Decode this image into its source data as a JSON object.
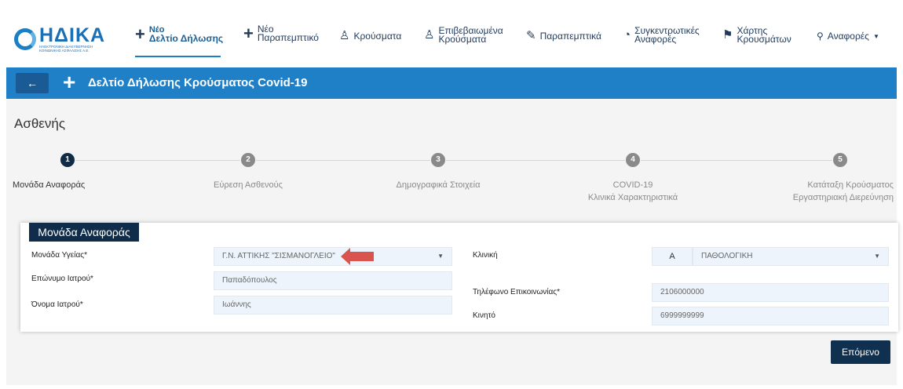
{
  "logo": {
    "title": "ΗΔΙΚΑ",
    "subtitle": "ΗΛΕΚΤΡΟΝΙΚΗ ΔΙΑΚΥΒΕΡΝΗΣΗ ΚΟΙΝΩΝΙΚΗΣ ΑΣΦΑΛΙΣΗΣ Α.Ε."
  },
  "nav": {
    "new_report_l1": "Νέο",
    "new_report_l2": "Δελτίο Δήλωσης",
    "new_ref_l1": "Νέο",
    "new_ref_l2": "Παραπεμπτικό",
    "cases": "Κρούσματα",
    "confirmed_l1": "Επιβεβαιωμένα",
    "confirmed_l2": "Κρούσματα",
    "referrals": "Παραπεμπτικά",
    "summary_l1": "Συγκεντρωτικές",
    "summary_l2": "Αναφορές",
    "map_l1": "Χάρτης",
    "map_l2": "Κρουσμάτων",
    "reports": "Αναφορές"
  },
  "titlebar": {
    "back": "←",
    "plus": "+",
    "title": "Δελτίο Δήλωσης Κρούσματος Covid-19"
  },
  "section_heading": "Ασθενής",
  "steps": [
    {
      "num": "1",
      "line1": "Μονάδα Αναφοράς",
      "line2": ""
    },
    {
      "num": "2",
      "line1": "Εύρεση Ασθενούς",
      "line2": ""
    },
    {
      "num": "3",
      "line1": "Δημογραφικά Στοιχεία",
      "line2": ""
    },
    {
      "num": "4",
      "line1": "COVID-19",
      "line2": "Κλινικά Χαρακτηριστικά"
    },
    {
      "num": "5",
      "line1": "Κατάταξη Κρούσματος",
      "line2": "Εργαστηριακή Διερεύνηση"
    }
  ],
  "form": {
    "tag": "Μονάδα Αναφοράς",
    "health_unit_label": "Μονάδα Υγείας*",
    "health_unit_value": "Γ.Ν. ΑΤΤΙΚΗΣ \"ΣΙΣΜΑΝΟΓΛΕΙΟ\"",
    "surname_label": "Επώνυμο Ιατρού*",
    "surname_value": "Παπαδόπουλος",
    "name_label": "Όνομα Ιατρού*",
    "name_value": "Ιωάννης",
    "clinic_label": "Κλινική",
    "clinic_code": "Α",
    "clinic_value": "ΠΑΘΟΛΟΓΙΚΗ",
    "phone_label": "Τηλέφωνο Επικοινωνίας*",
    "phone_value": "2106000000",
    "mobile_label": "Κινητό",
    "mobile_value": "6999999999"
  },
  "next_button": "Επόμενο",
  "colors": {
    "brand_blue": "#1f80c8",
    "dark_navy": "#0f2d4a",
    "arrow_red": "#d9534f"
  }
}
